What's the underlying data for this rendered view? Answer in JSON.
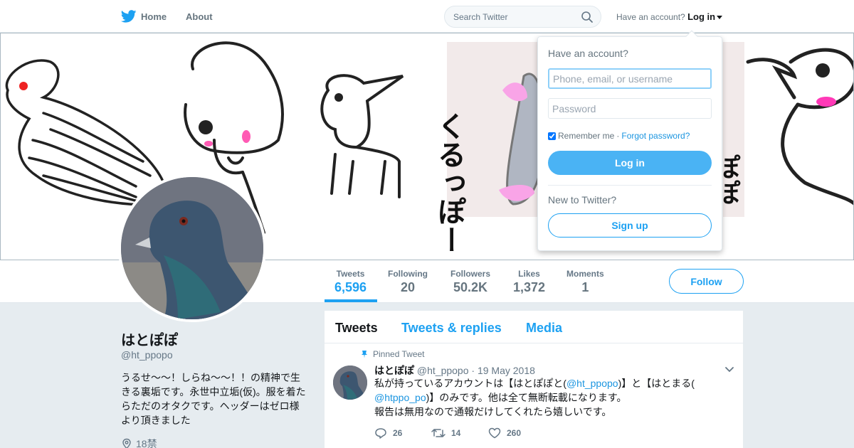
{
  "colors": {
    "accent": "#1da1f2",
    "login_button": "#4ab3f4",
    "page_bg": "#e6ecf0"
  },
  "topnav": {
    "home_label": "Home",
    "about_label": "About",
    "search_placeholder": "Search Twitter",
    "have_account_text": "Have an account?",
    "login_label": "Log in"
  },
  "login_dropdown": {
    "title": "Have an account?",
    "username_placeholder": "Phone, email, or username",
    "password_placeholder": "Password",
    "remember_me_label": "Remember me",
    "separator": "·",
    "forgot_password_label": "Forgot password?",
    "login_button_label": "Log in",
    "new_to_twitter_text": "New to Twitter?",
    "signup_button_label": "Sign up"
  },
  "profile_nav": {
    "stats": [
      {
        "label": "Tweets",
        "value": "6,596"
      },
      {
        "label": "Following",
        "value": "20"
      },
      {
        "label": "Followers",
        "value": "50.2K"
      },
      {
        "label": "Likes",
        "value": "1,372"
      },
      {
        "label": "Moments",
        "value": "1"
      }
    ],
    "follow_label": "Follow"
  },
  "profile": {
    "name": "はとぽぽ",
    "handle": "@ht_ppopo",
    "bio": "うるせ〜〜！しらね〜〜！！の精神で生きる裏垢です。永世中立垢(仮)。服を着たらただのオタクです。ヘッダーはゼロ様より頂きました",
    "location": "18禁"
  },
  "header_art": {
    "kana_column": "くるっぽー",
    "kana_right": "ぽぽ"
  },
  "timeline": {
    "tabs": [
      "Tweets",
      "Tweets & replies",
      "Media"
    ],
    "pinned_label": "Pinned Tweet",
    "tweet": {
      "author": "はとぽぽ",
      "handle": "@ht_ppopo",
      "date_sep": "·",
      "date": "19 May 2018",
      "text_1": "私が持っているアカウントは【はとぽぽと(",
      "mention_1": "@ht_ppopo",
      "text_2": ")】と【はとまる(",
      "mention_2": "@htppo_po",
      "text_3": ")】のみです。他は全て無断転載になります。",
      "text_4": "報告は無用なので通報だけしてくれたら嬉しいです。",
      "replies": "26",
      "retweets": "14",
      "likes": "260"
    }
  }
}
